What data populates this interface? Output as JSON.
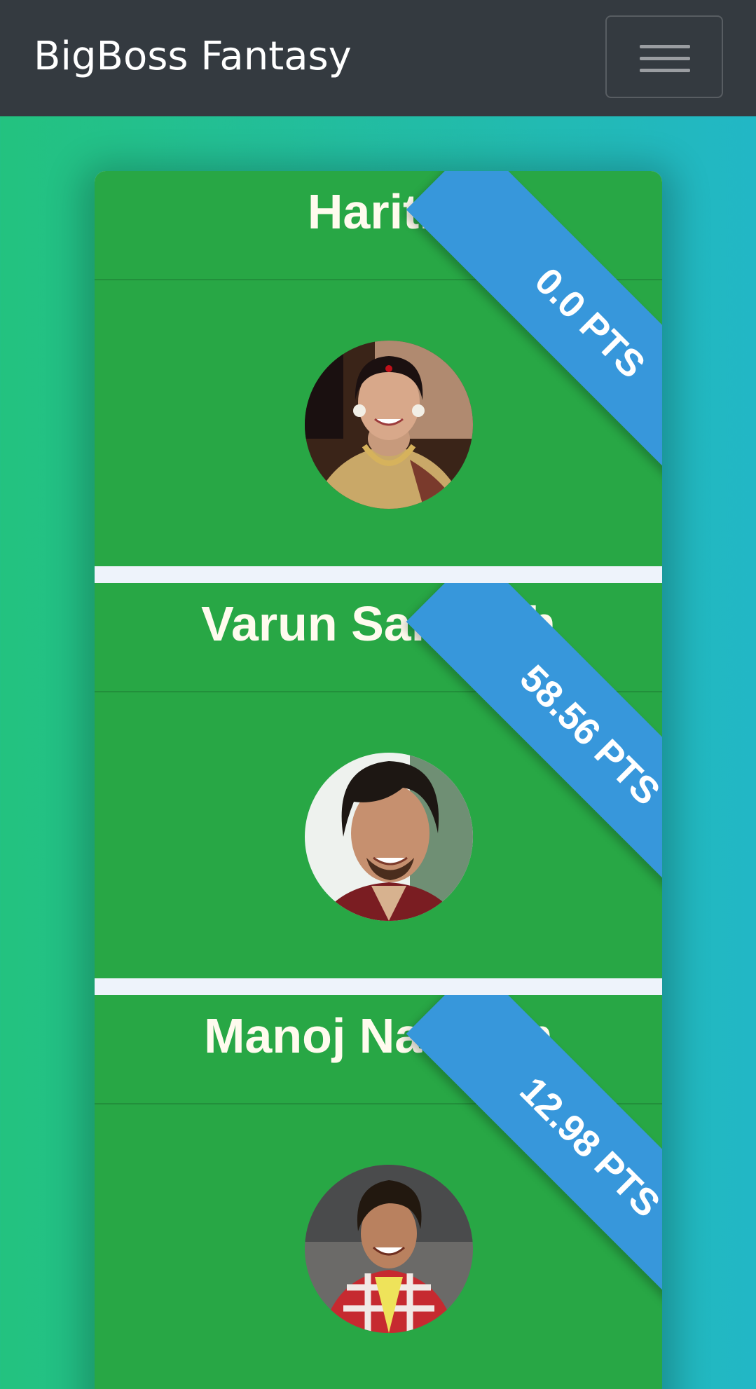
{
  "navbar": {
    "brand": "BigBoss Fantasy",
    "toggler_icon": "hamburger-menu-icon"
  },
  "contestants": [
    {
      "name": "Harith",
      "points": "0.0 PTS",
      "photo_icon": "contestant-photo"
    },
    {
      "name": "Varun Sandesh",
      "points": "58.56 PTS",
      "photo_icon": "contestant-photo"
    },
    {
      "name": "Manoj Nandam",
      "points": "12.98 PTS",
      "photo_icon": "contestant-photo"
    }
  ],
  "colors": {
    "navbar_bg": "#343a40",
    "card_bg": "#28a745",
    "ribbon_bg": "#3797db",
    "page_gradient_start": "#23c27f",
    "page_gradient_end": "#22b7c6"
  }
}
